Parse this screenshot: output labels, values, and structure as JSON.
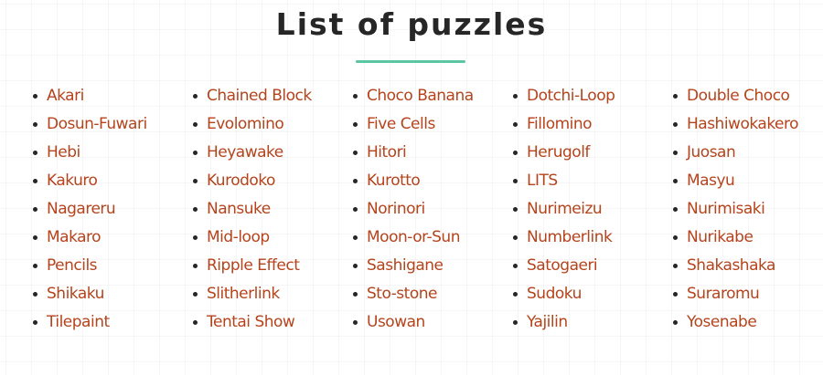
{
  "header": {
    "title": "List of puzzles"
  },
  "colors": {
    "link": "#b5431c",
    "title": "#262626",
    "accent_underline": "#5cc6a2",
    "bullet": "#262626"
  },
  "columns": [
    [
      "Akari",
      "Dosun-Fuwari",
      "Hebi",
      "Kakuro",
      "Nagareru",
      "Makaro",
      "Pencils",
      "Shikaku",
      "Tilepaint"
    ],
    [
      "Chained Block",
      "Evolomino",
      "Heyawake",
      "Kurodoko",
      "Nansuke",
      "Mid-loop",
      "Ripple Effect",
      "Slitherlink",
      "Tentai Show"
    ],
    [
      "Choco Banana",
      "Five Cells",
      "Hitori",
      "Kurotto",
      "Norinori",
      "Moon-or-Sun",
      "Sashigane",
      "Sto-stone",
      "Usowan"
    ],
    [
      "Dotchi-Loop",
      "Fillomino",
      "Herugolf",
      "LITS",
      "Nurimeizu",
      "Numberlink",
      "Satogaeri",
      "Sudoku",
      "Yajilin"
    ],
    [
      "Double Choco",
      "Hashiwokakero",
      "Juosan",
      "Masyu",
      "Nurimisaki",
      "Nurikabe",
      "Shakashaka",
      "Suraromu",
      "Yosenabe"
    ]
  ]
}
